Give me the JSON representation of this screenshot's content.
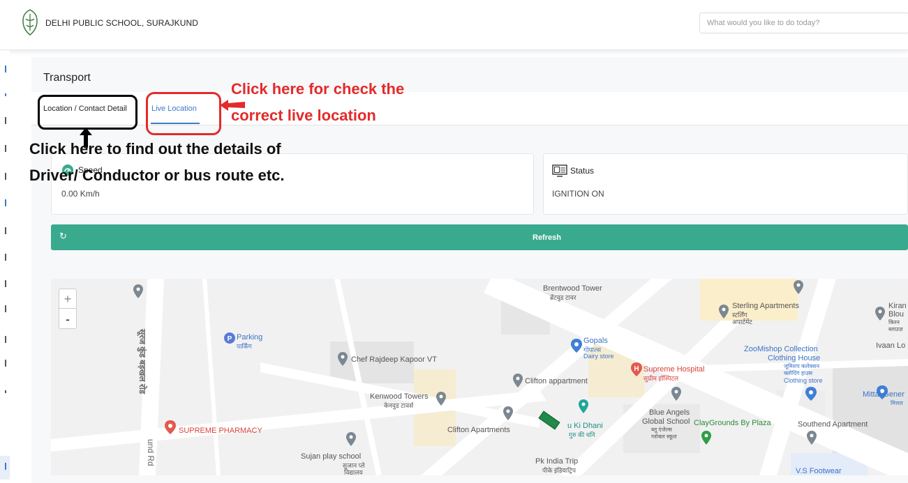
{
  "header": {
    "school_name": "DELHI PUBLIC SCHOOL, SURAJKUND",
    "search_placeholder": "What would you like to do today?"
  },
  "page": {
    "title": "Transport",
    "tabs": [
      {
        "label": "Location / Contact Detail"
      },
      {
        "label": "Live Location"
      }
    ]
  },
  "speed_card": {
    "label": "Speed",
    "value": "0.00 Km/h",
    "icon": "speedometer-icon"
  },
  "status_card": {
    "label": "Status",
    "value": "IGNITION ON",
    "icon": "monitor-icon"
  },
  "refresh": {
    "label": "Refresh",
    "icon": "refresh-icon",
    "color": "#3aaa8e"
  },
  "map": {
    "zoom_in": "+",
    "zoom_out": "-",
    "labels": {
      "road_vertical": "सूरज कुंड बड़खल रोड",
      "road_bottom": "und Rd",
      "brentwood": "Brentwood Tower",
      "brentwood_hi": "ब्रेंटवुड टावर",
      "parking": "Parking",
      "parking_hi": "पार्किंग",
      "gopals": "Gopals",
      "gopals_hi": "गोपाल्स",
      "gopals_sub": "Dairy store",
      "chef": "Chef Rajdeep Kapoor VT",
      "supreme_hospital": "Supreme Hospital",
      "supreme_hospital_hi": "सुप्रीम हॉस्पिटल",
      "clifton_appartment": "Clifton appartment",
      "kenwood": "Kenwood Towers",
      "kenwood_hi": "केनवुड टावर्स",
      "clifton_apartments": "Clifton Apartments",
      "ki_dhani": "u Ki Dhani",
      "ki_dhani_hi": "गुरु की धनि",
      "supreme_pharmacy": "SUPREME PHARMACY",
      "sujan": "Sujan play school",
      "sujan_hi": "सुजान प्ले",
      "sujan_hi2": "विद्यालय",
      "pk_india": "Pk India Trip",
      "pk_india_hi": "पीके इंडियाट्रिप",
      "sterling": "Sterling Apartments",
      "sterling_hi": "स्टर्लिंग",
      "sterling_hi2": "अपार्टमेंट",
      "zoomishop": "ZooMishop Collection",
      "clothing_house": "Clothing House",
      "clothing_hi": "जूमिशप कलेक्शन",
      "clothing_hi2": "क्लोदिंग हाउस",
      "clothing_store": "Clothing store",
      "blue_angels": "Blue Angels",
      "global_school": "Global School",
      "blue_angels_hi": "ब्लू एंजेल्स",
      "blue_angels_hi2": "ग्लोबल स्कूल",
      "claygrounds": "ClayGrounds By Plaza",
      "southend": "Southend Apartment",
      "mittal": "Mittal Gener",
      "mittal_hi": "मित्तल",
      "kiran": "Kiran",
      "kiran2": "Blou",
      "kiran_hi": "किरन",
      "kiran_hi2": "ब्लाउज़",
      "ivaan": "Ivaan Lo",
      "vs_footwear": "V.S Footwear"
    }
  },
  "annotations": {
    "red_line1": "Click here for check the",
    "red_line2": "correct live location",
    "black_line1": "Click here to find out the details of",
    "black_line2": "Driver/ Conductor or bus route etc."
  },
  "colors": {
    "accent": "#3aaa8e",
    "tab_active": "#3d78c9",
    "annotation_red": "#e42a2a"
  }
}
